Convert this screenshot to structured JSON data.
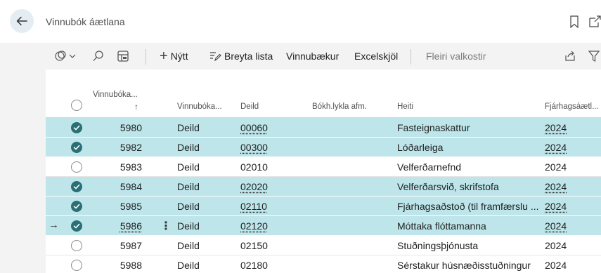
{
  "header": {
    "title": "Vinnubók áætlana",
    "back_icon": "arrow-left-icon",
    "bookmark_icon": "bookmark-icon",
    "open_new_icon": "open-in-new-window-icon"
  },
  "toolbar": {
    "analysis_icon": "analysis-mode-icon",
    "search_icon": "search-icon",
    "view_icon": "view-layout-icon",
    "new_label": "Nýtt",
    "edit_list_label": "Breyta lista",
    "workbooks_label": "Vinnubækur",
    "excel_label": "Excelskjöl",
    "more_label": "Fleiri valkostir",
    "share_icon": "share-icon",
    "filter_icon": "filter-icon"
  },
  "columns": {
    "workbook_no": "Vinnubóka...",
    "sort_arrow": "↑",
    "workbook_type": "Vinnubóka...",
    "department": "Deild",
    "account_schedule": "Bókh.lykla afm.",
    "name": "Heiti",
    "budget_year": "Fjárhagsáætl..."
  },
  "rows": [
    {
      "selected": true,
      "no": "5980",
      "type": "Deild",
      "dept": "00060",
      "dept_link": true,
      "name": "Fasteignaskattur",
      "year": "2024",
      "year_link": true
    },
    {
      "selected": true,
      "no": "5982",
      "type": "Deild",
      "dept": "00300",
      "dept_link": true,
      "name": "Lóðarleiga",
      "year": "2024",
      "year_link": true
    },
    {
      "selected": false,
      "no": "5983",
      "type": "Deild",
      "dept": "02010",
      "dept_link": false,
      "name": "Velferðarnefnd",
      "year": "2024",
      "year_link": false
    },
    {
      "selected": true,
      "no": "5984",
      "type": "Deild",
      "dept": "02020",
      "dept_link": true,
      "name": "Velferðarsvið, skrifstofa",
      "year": "2024",
      "year_link": true
    },
    {
      "selected": true,
      "no": "5985",
      "type": "Deild",
      "dept": "02110",
      "dept_link": true,
      "name": "Fjárhagsaðstoð (til framfærslu ...",
      "year": "2024",
      "year_link": true
    },
    {
      "selected": true,
      "no": "5986",
      "type": "Deild",
      "dept": "02120",
      "dept_link": true,
      "name": "Móttaka flóttamanna",
      "year": "2024",
      "year_link": true,
      "current": true
    },
    {
      "selected": false,
      "no": "5987",
      "type": "Deild",
      "dept": "02150",
      "dept_link": false,
      "name": "Stuðningsþjónusta",
      "year": "2024",
      "year_link": false
    },
    {
      "selected": false,
      "no": "5988",
      "type": "Deild",
      "dept": "02180",
      "dept_link": false,
      "name": "Sérstakur húsnæðisstuðningur",
      "year": "2024",
      "year_link": false
    }
  ],
  "colors": {
    "selected_row": "#bde5ea",
    "checkbox_on": "#2a6f75",
    "back_button_bg": "#e4eef2"
  }
}
